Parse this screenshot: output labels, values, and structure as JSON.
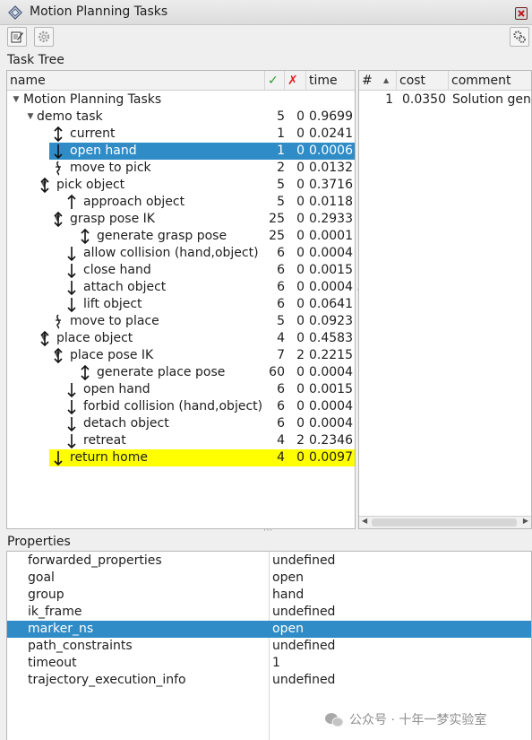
{
  "window": {
    "title": "Motion Planning Tasks",
    "icon": "rviz-panel-icon"
  },
  "toolbar": {
    "left_buttons": [
      "edit-icon",
      "gear-icon"
    ],
    "right_button": "gears-icon"
  },
  "task_tree": {
    "label": "Task Tree",
    "columns": {
      "name": "name",
      "success": "✓",
      "failed": "✗",
      "time": "time"
    },
    "rows": [
      {
        "name": "Motion Planning Tasks",
        "icon": "none",
        "arrow": "expanded",
        "success": "",
        "failed": "",
        "time": ""
      },
      {
        "name": "demo task",
        "icon": "none",
        "arrow": "expanded",
        "success": "5",
        "failed": "0",
        "time": "0.9699"
      },
      {
        "name": "current",
        "icon": "bidirectional-icon",
        "arrow": "",
        "success": "1",
        "failed": "0",
        "time": "0.0241"
      },
      {
        "name": "open hand",
        "icon": "down-arrow-icon",
        "arrow": "",
        "success": "1",
        "failed": "0",
        "time": "0.0006",
        "state": "selected"
      },
      {
        "name": "move to pick",
        "icon": "connect-icon",
        "arrow": "",
        "success": "2",
        "failed": "0",
        "time": "0.0132"
      },
      {
        "name": "pick object",
        "icon": "bidirectional-icon",
        "arrow": "expanded",
        "success": "5",
        "failed": "0",
        "time": "0.3716"
      },
      {
        "name": "approach object",
        "icon": "up-arrow-icon",
        "arrow": "",
        "success": "5",
        "failed": "0",
        "time": "0.0118"
      },
      {
        "name": "grasp pose IK",
        "icon": "bidirectional-icon",
        "arrow": "expanded",
        "success": "25",
        "failed": "0",
        "time": "0.2933"
      },
      {
        "name": "generate grasp pose",
        "icon": "bidirectional-icon",
        "arrow": "",
        "success": "25",
        "failed": "0",
        "time": "0.0001"
      },
      {
        "name": "allow collision (hand,object)",
        "icon": "down-arrow-icon",
        "arrow": "",
        "success": "6",
        "failed": "0",
        "time": "0.0004"
      },
      {
        "name": "close hand",
        "icon": "down-arrow-icon",
        "arrow": "",
        "success": "6",
        "failed": "0",
        "time": "0.0015"
      },
      {
        "name": "attach object",
        "icon": "down-arrow-icon",
        "arrow": "",
        "success": "6",
        "failed": "0",
        "time": "0.0004"
      },
      {
        "name": "lift object",
        "icon": "down-arrow-icon",
        "arrow": "",
        "success": "6",
        "failed": "0",
        "time": "0.0641"
      },
      {
        "name": "move to place",
        "icon": "connect-icon",
        "arrow": "",
        "success": "5",
        "failed": "0",
        "time": "0.0923"
      },
      {
        "name": "place object",
        "icon": "bidirectional-icon",
        "arrow": "expanded",
        "success": "4",
        "failed": "0",
        "time": "0.4583"
      },
      {
        "name": "place pose IK",
        "icon": "bidirectional-icon",
        "arrow": "expanded",
        "success": "7",
        "failed": "2",
        "time": "0.2215"
      },
      {
        "name": "generate place pose",
        "icon": "bidirectional-icon",
        "arrow": "",
        "success": "60",
        "failed": "0",
        "time": "0.0004"
      },
      {
        "name": "open hand",
        "icon": "down-arrow-icon",
        "arrow": "",
        "success": "6",
        "failed": "0",
        "time": "0.0015"
      },
      {
        "name": "forbid collision (hand,object)",
        "icon": "down-arrow-icon",
        "arrow": "",
        "success": "6",
        "failed": "0",
        "time": "0.0004"
      },
      {
        "name": "detach object",
        "icon": "down-arrow-icon",
        "arrow": "",
        "success": "6",
        "failed": "0",
        "time": "0.0004"
      },
      {
        "name": "retreat",
        "icon": "down-arrow-icon",
        "arrow": "",
        "success": "4",
        "failed": "2",
        "time": "0.2346"
      },
      {
        "name": "return home",
        "icon": "down-arrow-icon",
        "arrow": "",
        "success": "4",
        "failed": "0",
        "time": "0.0097",
        "state": "highlighted"
      }
    ]
  },
  "solutions": {
    "columns": {
      "index": "#",
      "cost": "cost",
      "comment": "comment"
    },
    "rows": [
      {
        "index": "1",
        "cost": "0.0350",
        "comment": "Solution gene"
      }
    ]
  },
  "properties": {
    "label": "Properties",
    "rows": [
      {
        "key": "forwarded_properties",
        "value": "undefined"
      },
      {
        "key": "goal",
        "value": "open"
      },
      {
        "key": "group",
        "value": "hand"
      },
      {
        "key": "ik_frame",
        "value": "undefined"
      },
      {
        "key": "marker_ns",
        "value": "open",
        "state": "selected"
      },
      {
        "key": "path_constraints",
        "value": "undefined"
      },
      {
        "key": "timeout",
        "value": "1"
      },
      {
        "key": "trajectory_execution_info",
        "value": "undefined"
      }
    ]
  },
  "watermark": {
    "text": "公众号 · 十年一梦实验室"
  },
  "colors": {
    "selection": "#308cc6",
    "highlight": "#ffff00",
    "success_check": "#2e9e2e",
    "failure_x": "#e02020"
  }
}
